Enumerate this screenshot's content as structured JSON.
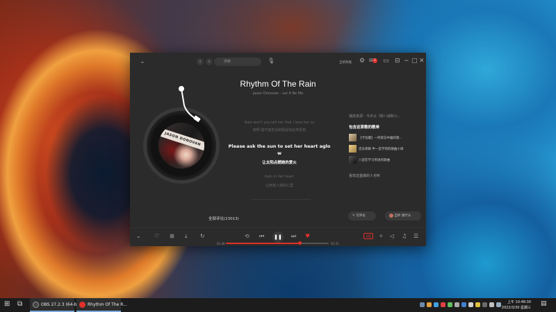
{
  "app": {
    "titlebar": {
      "search_placeholder": "搜索",
      "promo_text": "全新改版",
      "message_badge": "1"
    },
    "song": {
      "title": "Rhythm Of The Rain",
      "subtitle": "Jason Donovan - Let It Be Me"
    },
    "cover_band_text": "JASON DONOVAN",
    "lyrics": {
      "prev_line": "Rain won't you tell her that I love her so",
      "prev_trans": "雨啊 能不能告诉她我是如此地爱她",
      "active_line": "Please ask the sun to set her heart aglo",
      "active_wrap": "w",
      "active_trans": "让太阳点燃她的爱火",
      "next_line": "Rain in her heart",
      "next_trans": "让雨落入她的心里"
    },
    "right_panel": {
      "intro": "播放来源：今天从《新八城和小...",
      "heading": "包含这首歌的歌单",
      "playlists": [
        {
          "label": "【卡拉趣】一听就忘中幽的歌..."
        },
        {
          "label": "还去郭颖 半一首学到的歌曲小调"
        },
        {
          "label": "八首在学习英语的歌曲"
        }
      ],
      "similar": "喜欢这首歌的人也听"
    },
    "comments": {
      "count_label": "全部评论(13013)",
      "write_label": "写评论",
      "listen_label": "自听 想什么"
    },
    "player": {
      "time_current": "01:48",
      "time_total": "02:31",
      "progress": 0.72,
      "quality_label": "无损"
    }
  },
  "taskbar": {
    "apps": [
      {
        "label": "OBS 27.2.3 (64-bi..."
      },
      {
        "label": "Rhythm Of The R..."
      }
    ],
    "clock_time": "上午 10:48:30",
    "clock_date": "2022/3/30 星期三"
  },
  "colors": {
    "accent": "#e0312d",
    "window_bg": "#2b2b2b",
    "taskbar_bg": "#1c1c1c"
  }
}
